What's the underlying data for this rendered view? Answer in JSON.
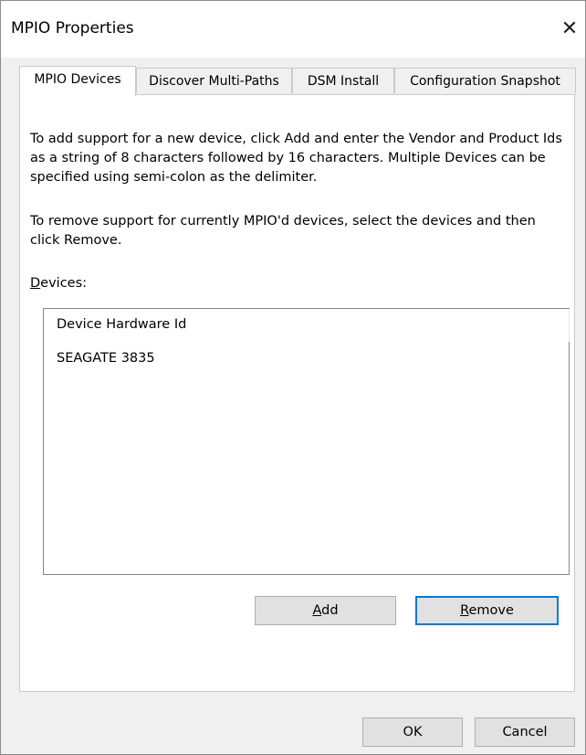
{
  "window": {
    "title": "MPIO Properties",
    "close_glyph": "✕"
  },
  "tabs": [
    {
      "label": "MPIO Devices",
      "active": true
    },
    {
      "label": "Discover Multi-Paths",
      "active": false
    },
    {
      "label": "DSM Install",
      "active": false
    },
    {
      "label": "Configuration Snapshot",
      "active": false
    }
  ],
  "panel": {
    "instructions_add": "To add support for a new device, click Add and enter the Vendor and Product Ids as a string of 8 characters followed by 16 characters. Multiple Devices can be specified using semi-colon as the delimiter.",
    "instructions_remove": "To remove support for currently MPIO'd devices, select the devices and then click Remove.",
    "devices_label_mnemonic": "D",
    "devices_label_rest": "evices:",
    "list_header": "Device Hardware Id",
    "devices": [
      "SEAGATE 3835"
    ],
    "add_button": {
      "mnemonic": "A",
      "rest": "dd"
    },
    "remove_button": {
      "mnemonic": "R",
      "rest": "emove"
    }
  },
  "footer": {
    "ok_label": "OK",
    "cancel_label": "Cancel"
  }
}
